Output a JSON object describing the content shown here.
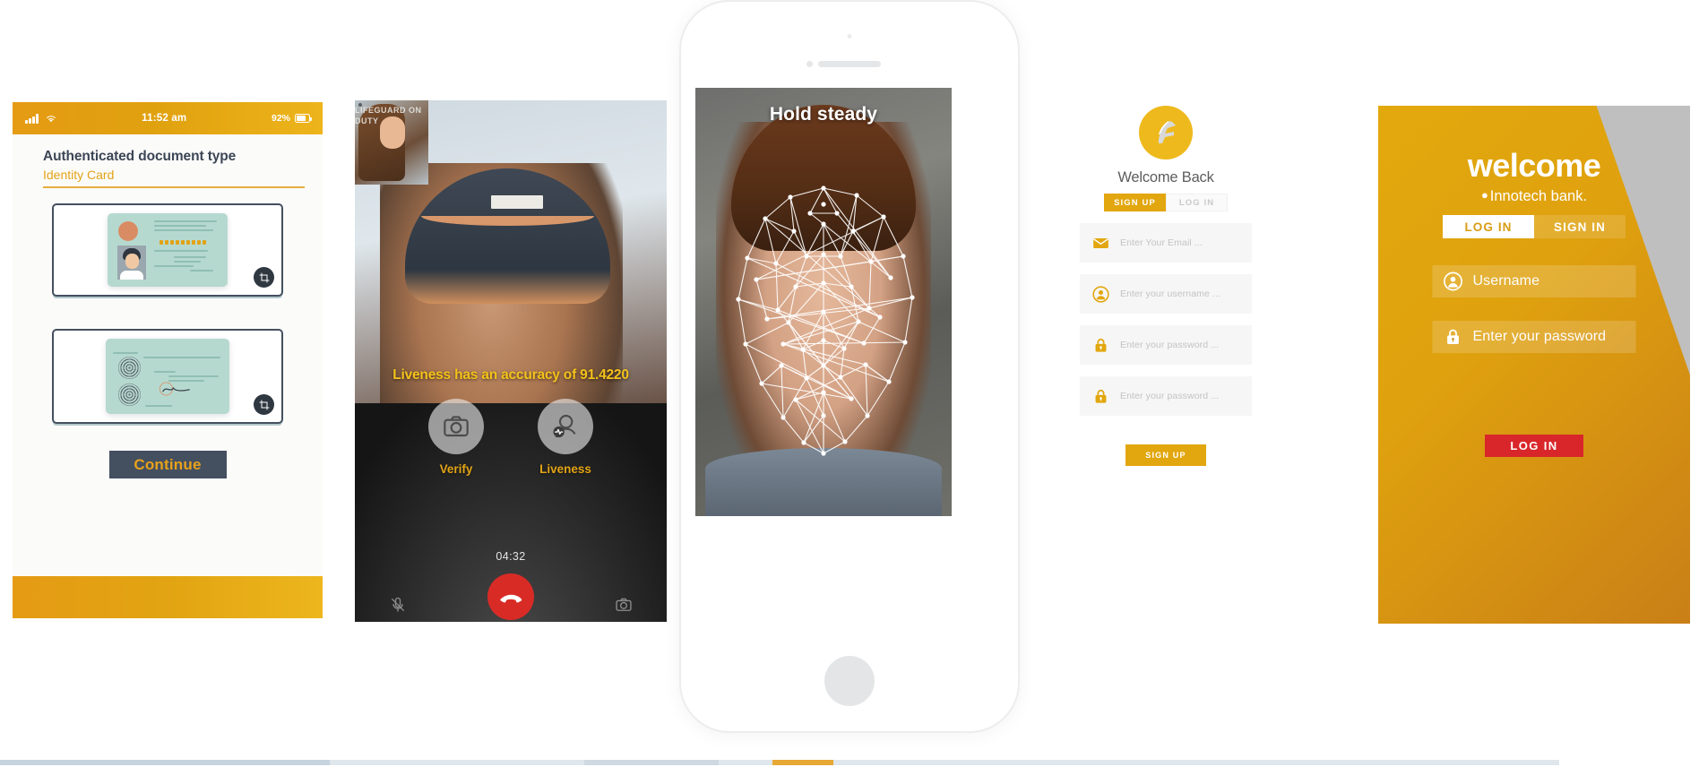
{
  "document_panel": {
    "status_bar": {
      "time": "11:52 am",
      "battery": "92%",
      "signal_icon": "signal-bars-icon",
      "wifi_icon": "wifi-icon",
      "battery_icon": "battery-icon"
    },
    "title": "Authenticated document type",
    "subtitle": "Identity Card",
    "front_frame_label": "id-card-front",
    "back_frame_label": "id-card-back",
    "crop_icon": "crop-icon",
    "continue_label": "Continue"
  },
  "call_panel": {
    "accuracy_text": "Liveness has an accuracy of 91.4220",
    "actions": [
      {
        "label": "Verify",
        "icon": "camera-icon"
      },
      {
        "label": "Liveness",
        "icon": "person-pulse-icon"
      }
    ],
    "timer": "04:32",
    "hangup_icon": "hangup-phone-icon",
    "pip_label": "LIFEGUARD\nON DUTY",
    "mute_icon": "mic-off-icon",
    "camera_icon": "camera-icon"
  },
  "phone_panel": {
    "overlay_title": "Hold steady",
    "mesh_label": "face-mesh-overlay",
    "speaker_label": "phone-speaker",
    "home_label": "phone-home-button"
  },
  "signup_panel": {
    "logo_icon": "innotech-logo-icon",
    "heading": "Welcome Back",
    "tabs": [
      {
        "label": "SIGN UP",
        "active": true
      },
      {
        "label": "LOG IN",
        "active": false
      }
    ],
    "fields": [
      {
        "icon": "envelope-icon",
        "placeholder": "Enter Your Email ..."
      },
      {
        "icon": "user-circle-icon",
        "placeholder": "Enter your username ..."
      },
      {
        "icon": "lock-icon",
        "placeholder": "Enter your password ..."
      },
      {
        "icon": "lock-icon",
        "placeholder": "Enter your password ..."
      }
    ],
    "submit_label": "SIGN UP"
  },
  "welcome_panel": {
    "title": "welcome",
    "bullet": "●",
    "subtitle": "Innotech bank.",
    "tabs": [
      {
        "label": "LOG IN",
        "active": true
      },
      {
        "label": "SIGN IN",
        "active": false
      }
    ],
    "username_field": {
      "icon": "user-circle-icon",
      "value": "Username"
    },
    "password_field": {
      "icon": "lock-icon",
      "value": "Enter your password"
    },
    "submit_label": "LOG IN"
  },
  "colors": {
    "gold": "#e2a70f",
    "gold_dark": "#c97f17",
    "slate": "#44505f",
    "card_teal": "#b6d9cf",
    "red": "#d9262b",
    "call_red": "#d92b26",
    "liveness_yellow": "#f4c21a"
  }
}
